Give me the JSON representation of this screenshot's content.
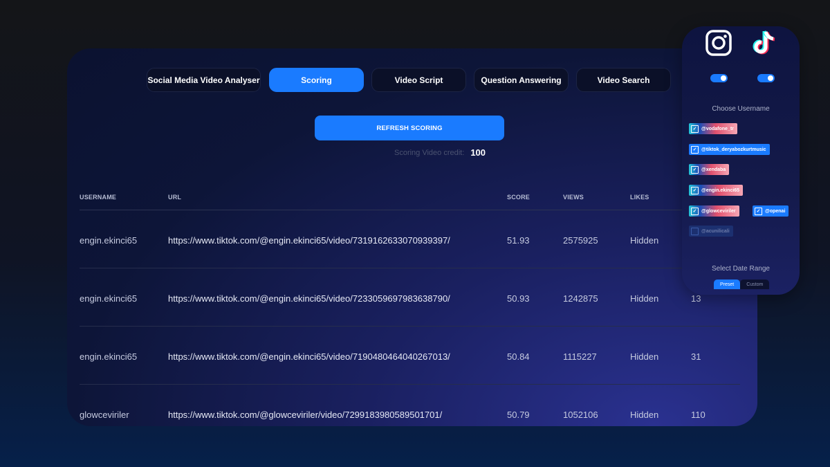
{
  "tabs": [
    {
      "label": "Social Media Video Analyser",
      "active": false
    },
    {
      "label": "Scoring",
      "active": true
    },
    {
      "label": "Video Script",
      "active": false
    },
    {
      "label": "Question Answering",
      "active": false
    },
    {
      "label": "Video Search",
      "active": false
    }
  ],
  "refresh_button": "REFRESH SCORING",
  "credit": {
    "label": "Scoring Video credit:",
    "value": "100"
  },
  "table": {
    "headers": {
      "username": "USERNAME",
      "url": "URL",
      "score": "SCORE",
      "views": "VIEWS",
      "likes": "LIKES"
    },
    "rows": [
      {
        "username": "engin.ekinci65",
        "url": "https://www.tiktok.com/@engin.ekinci65/video/7319162633070939397/",
        "score": "51.93",
        "views": "2575925",
        "likes": "Hidden",
        "extra": ""
      },
      {
        "username": "engin.ekinci65",
        "url": "https://www.tiktok.com/@engin.ekinci65/video/7233059697983638790/",
        "score": "50.93",
        "views": "1242875",
        "likes": "Hidden",
        "extra": "13"
      },
      {
        "username": "engin.ekinci65",
        "url": "https://www.tiktok.com/@engin.ekinci65/video/7190480464040267013/",
        "score": "50.84",
        "views": "1115227",
        "likes": "Hidden",
        "extra": "31"
      },
      {
        "username": "glowceviriler",
        "url": "https://www.tiktok.com/@glowceviriler/video/7299183980589501701/",
        "score": "50.79",
        "views": "1052106",
        "likes": "Hidden",
        "extra": "110"
      }
    ]
  },
  "side": {
    "platforms": [
      {
        "icon": "instagram-icon",
        "enabled": true
      },
      {
        "icon": "tiktok-icon",
        "enabled": true
      }
    ],
    "choose_username": "Choose Username",
    "usernames": [
      {
        "label": "@vodafone_tr",
        "checked": true,
        "style": "grad"
      },
      {
        "label": "@tiktok_deryabozkurtmusic",
        "checked": true,
        "style": "solid"
      },
      {
        "label": "@xendaba",
        "checked": true,
        "style": "grad"
      },
      {
        "label": "@engin.ekinci65",
        "checked": true,
        "style": "grad"
      },
      {
        "label": "@glowceviriler",
        "checked": true,
        "style": "grad"
      },
      {
        "label": "@openai",
        "checked": true,
        "style": "solid"
      },
      {
        "label": "@acunilicali",
        "checked": false,
        "style": "dim"
      }
    ],
    "select_date_range": "Select Date Range",
    "date_tabs": [
      {
        "label": "Preset",
        "active": true
      },
      {
        "label": "Custom",
        "active": false
      }
    ]
  },
  "colors": {
    "accent": "#1a7bff",
    "background": "#0f1424",
    "panel": "#0d1538"
  }
}
